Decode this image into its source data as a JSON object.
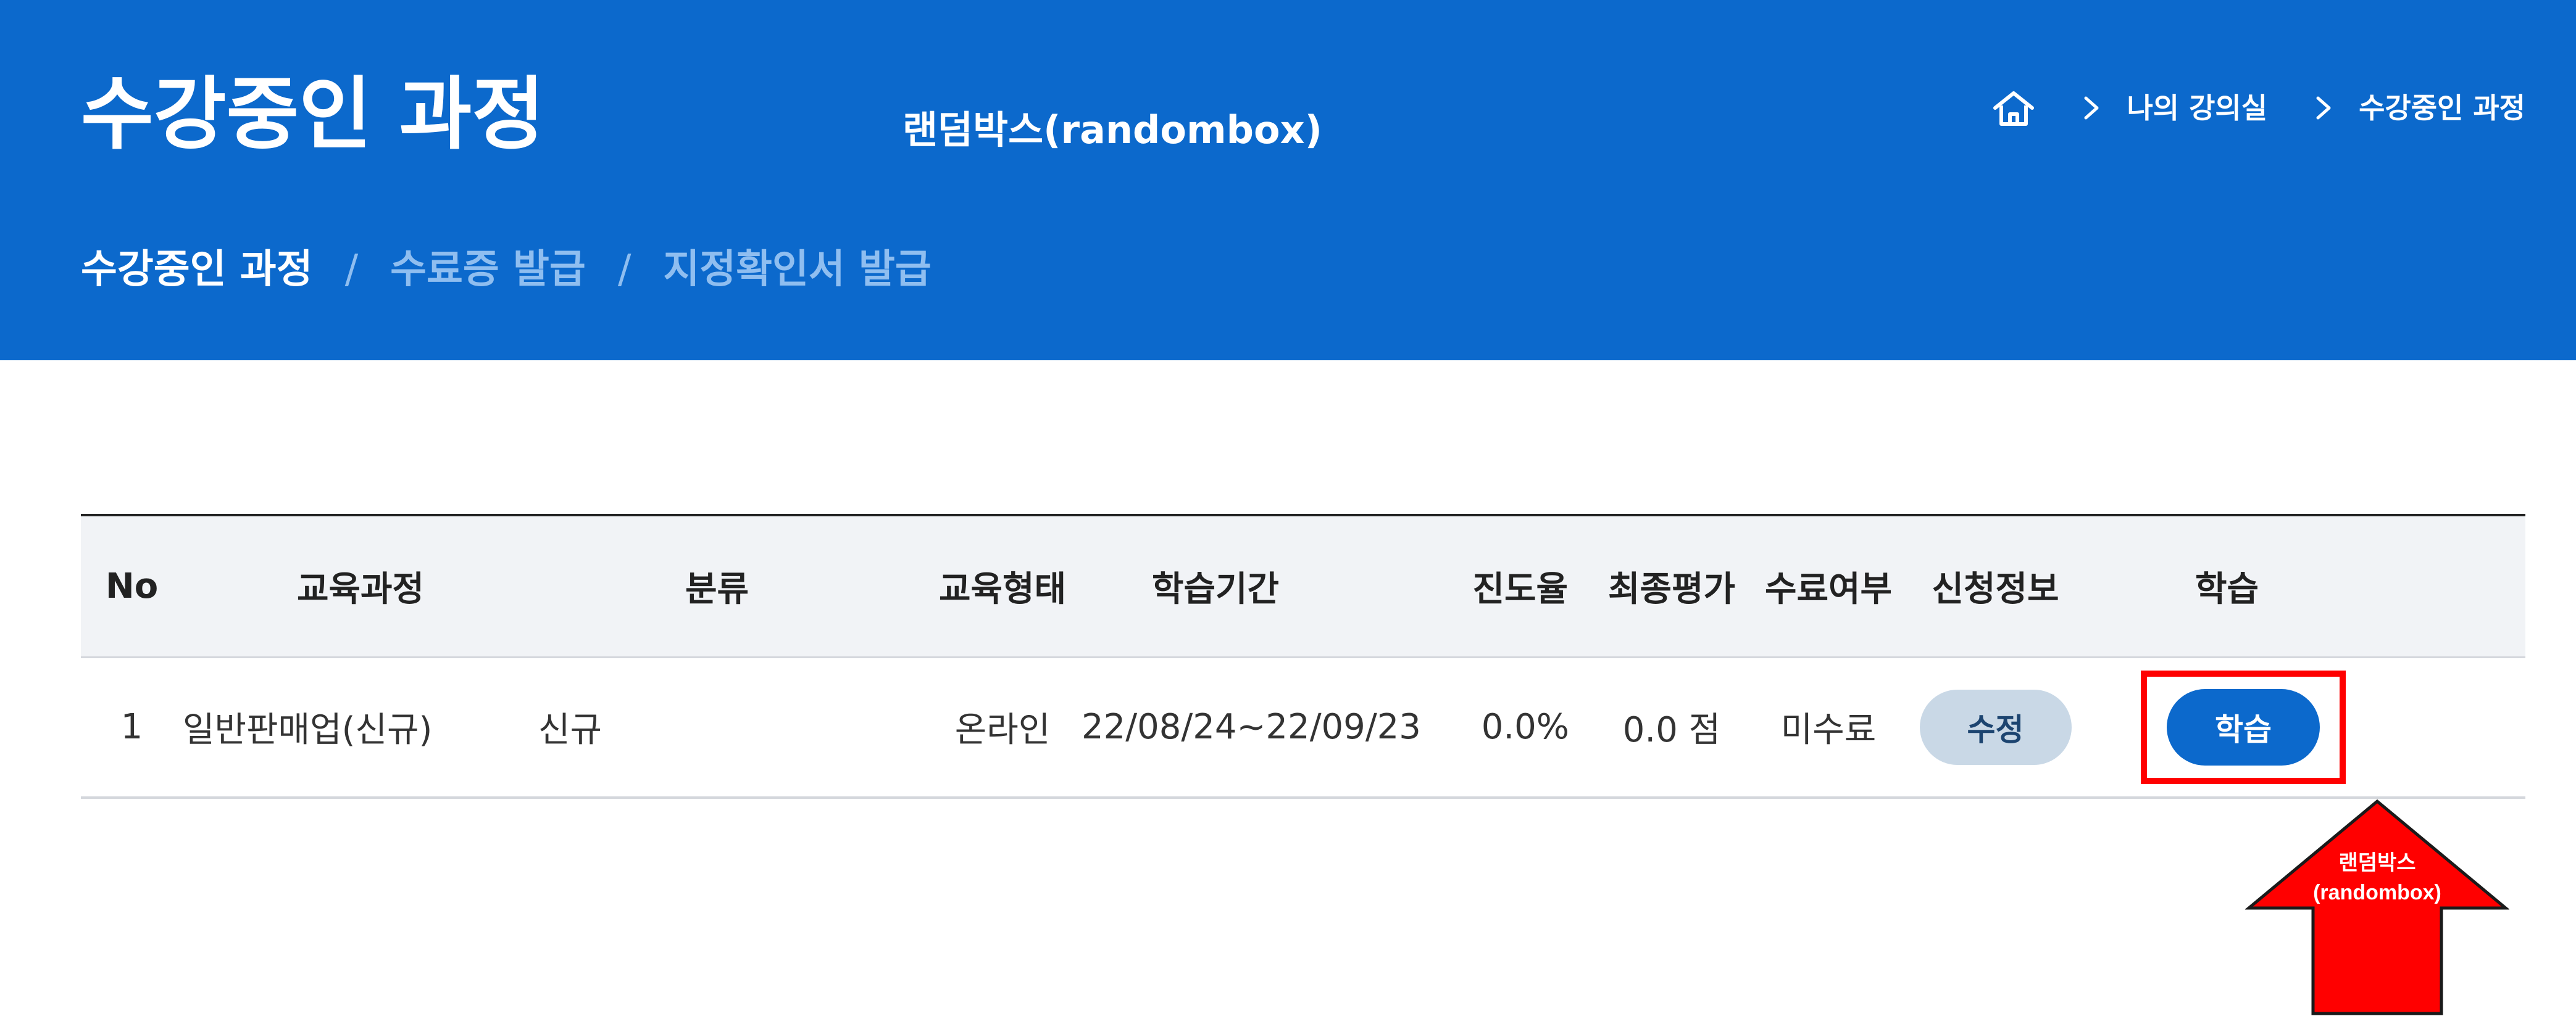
{
  "header": {
    "title": "수강중인 과정",
    "brand_note": "랜덤박스(randombox)",
    "breadcrumb": [
      "나의 강의실",
      "수강중인 과정"
    ]
  },
  "subnav": {
    "items": [
      "수강중인 과정",
      "수료증 발급",
      "지정확인서 발급"
    ],
    "separator": "/",
    "active": "수강중인 과정"
  },
  "table": {
    "headers": [
      "No",
      "교육과정",
      "분류",
      "교육형태",
      "학습기간",
      "진도율",
      "최종평가",
      "수료여부",
      "신청정보",
      "학습"
    ],
    "rows": [
      {
        "no": "1",
        "course": "일반판매업(신규)",
        "category": "신규",
        "type": "온라인",
        "period": "22/08/24~22/09/23",
        "progress": "0.0%",
        "final_eval": "0.0 점",
        "completion": "미수료",
        "edit_button": "수정",
        "study_button": "학습"
      }
    ]
  },
  "annotation": {
    "label_line1": "랜덤박스",
    "label_line2": "(randombox)",
    "arrow_color": "#ff0000",
    "highlight_color": "#ff0000"
  },
  "colors": {
    "brand_blue": "#0c69cc",
    "header_row_bg": "#f1f3f6",
    "edit_button_bg": "#c9d8e6"
  }
}
